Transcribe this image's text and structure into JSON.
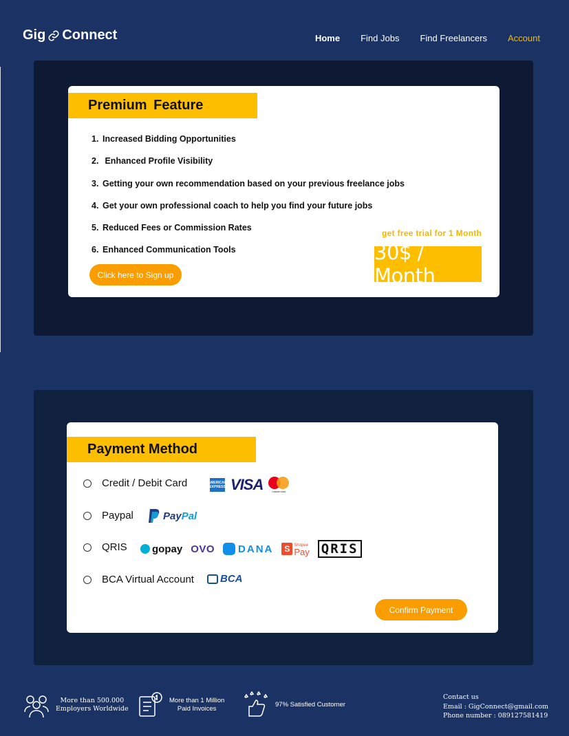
{
  "header": {
    "logo_left": "Gig",
    "logo_right": "Connect",
    "nav": [
      {
        "label": "Home"
      },
      {
        "label": "Find Jobs"
      },
      {
        "label": "Find Freelancers"
      },
      {
        "label": "Account"
      }
    ]
  },
  "premium": {
    "title": "Premium  Feature",
    "features": [
      {
        "num": "1.",
        "text": "Increased Bidding Opportunities"
      },
      {
        "num": "2.",
        "text": " Enhanced Profile Visibility"
      },
      {
        "num": "3.",
        "text": "Getting your own recommendation based on your previous freelance jobs"
      },
      {
        "num": "4.",
        "text": "Get your own professional coach to help you find your future jobs"
      },
      {
        "num": "5.",
        "text": "Reduced Fees or Commission Rates"
      },
      {
        "num": "6.",
        "text": "Enhanced Communication Tools"
      }
    ],
    "signup_label": "Click here to Sign up",
    "trial_text": "get free trial for 1 Month",
    "price": "30$ / Month"
  },
  "payment": {
    "title": "Payment Method",
    "options": [
      {
        "label": "Credit / Debit Card"
      },
      {
        "label": "Paypal"
      },
      {
        "label": "QRIS"
      },
      {
        "label": "BCA Virtual Account"
      }
    ],
    "logos": {
      "amex": "AMERICAN EXPRESS",
      "visa": "VISA",
      "mastercard": "mastercard",
      "paypal_a": "Pay",
      "paypal_b": "Pal",
      "gopay": "gopay",
      "ovo": "OVO",
      "dana": "DANA",
      "shopee_top": "Shopee",
      "shopee_bottom": "Pay",
      "qris": "QRIS",
      "bca": "BCA"
    },
    "confirm_label": "Confirm Payment"
  },
  "footer": {
    "stats": [
      {
        "line1": "More than 500.000",
        "line2": "Employers Worldwide",
        "icon": "users-icon"
      },
      {
        "line1": "More than 1 Million",
        "line2": "Paid Invoices",
        "icon": "invoice-icon"
      },
      {
        "line1": "97% Satisfied Customer",
        "line2": "",
        "icon": "thumbs-up-stars-icon"
      }
    ],
    "contact": {
      "title": "Contact us",
      "email": "Email : GigConnect@gmail.com",
      "phone": "Phone number : 089127581419"
    }
  },
  "colors": {
    "background": "#1b3264",
    "accent_yellow": "#fdbe00",
    "button_orange": "#f99d00",
    "active_nav": "#f5b800"
  }
}
